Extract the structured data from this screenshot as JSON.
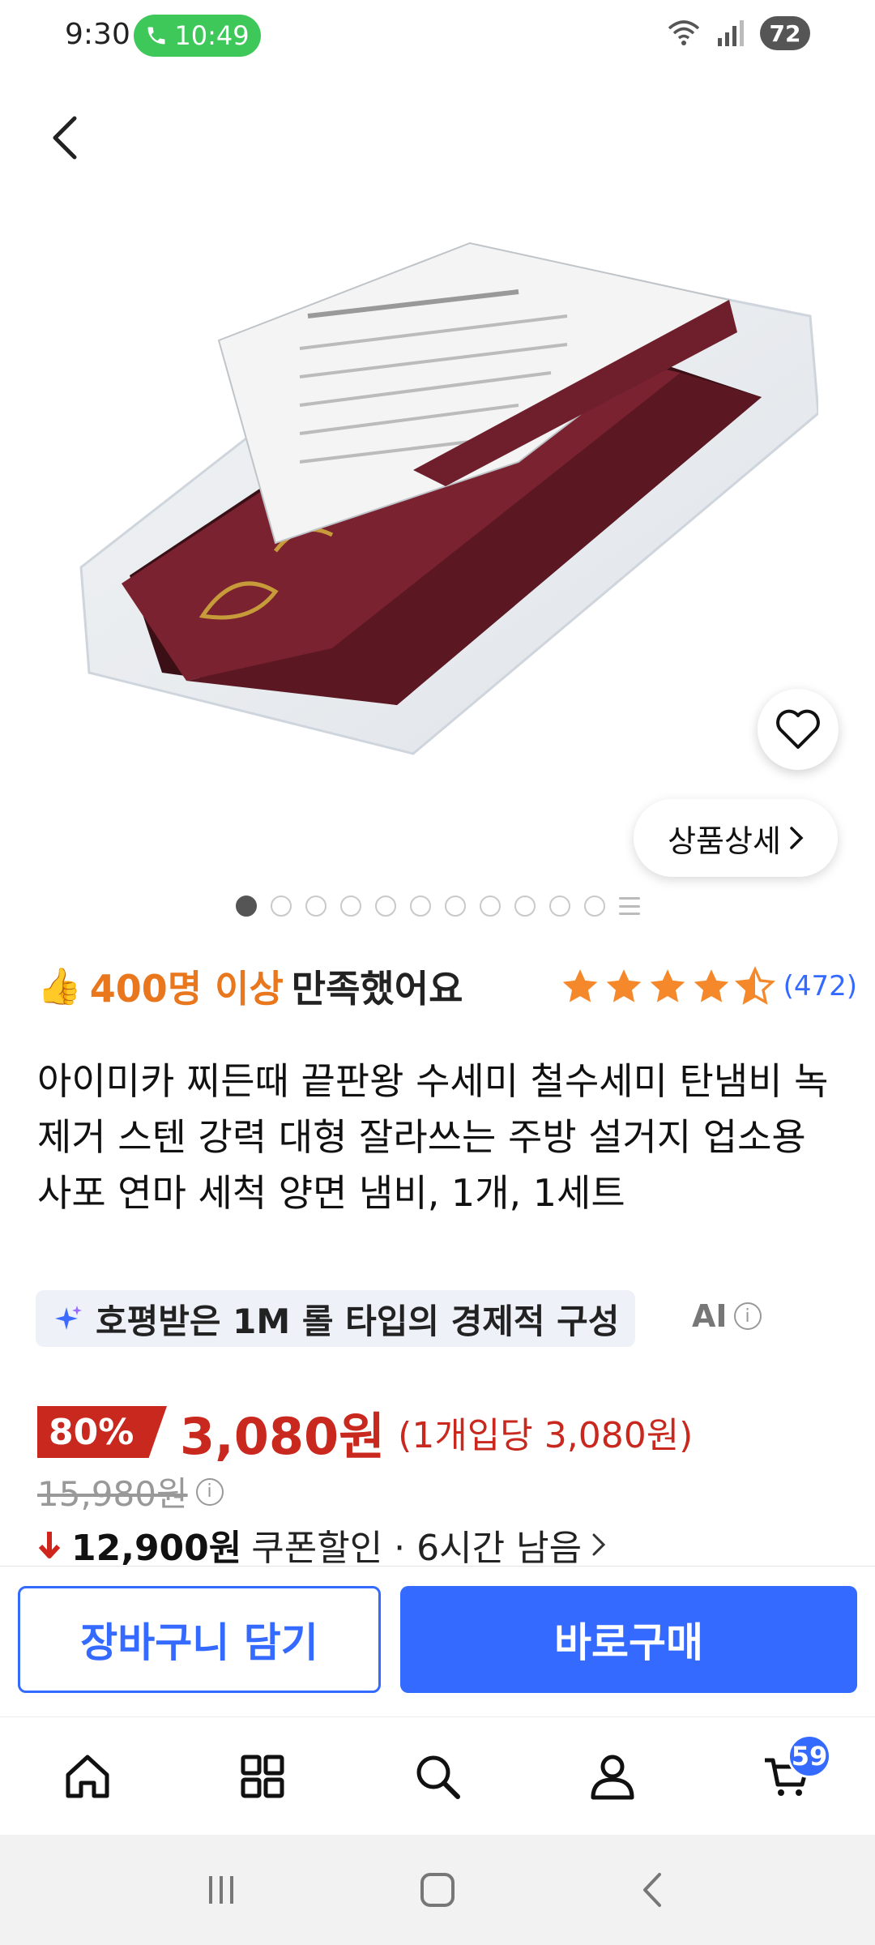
{
  "status_bar": {
    "time": "9:30",
    "call_time": "10:49",
    "battery": "72"
  },
  "hero": {
    "detail_label": "상품상세",
    "page_dot_count": 11,
    "active_dot_index": 0
  },
  "satisfaction": {
    "count_text": "400명 이상",
    "text": "만족했어요"
  },
  "rating": {
    "stars": 4.5,
    "review_count": "(472)",
    "star_color": "#f5882a"
  },
  "product": {
    "title": "아이미카 찌든때 끝판왕 수세미 철수세미 탄냄비 녹제거 스텐 강력 대형 잘라쓰는 주방 설거지 업소용 사포 연마 세척 양면 냄비, 1개, 1세트"
  },
  "ai_summary": {
    "text": "호평받은 1M 롤 타입의 경제적 구성",
    "label": "AI"
  },
  "price": {
    "discount": "80%",
    "sale_price": "3,080원",
    "unit_price": "(1개입당 3,080원)",
    "original_price": "15,980원",
    "coupon_price": "12,900원",
    "coupon_text": "쿠폰할인 · 6시간 남음"
  },
  "actions": {
    "cart_label": "장바구니 담기",
    "buy_label": "바로구매"
  },
  "bottom_nav": {
    "cart_badge": "59",
    "accent": "#346aff"
  }
}
